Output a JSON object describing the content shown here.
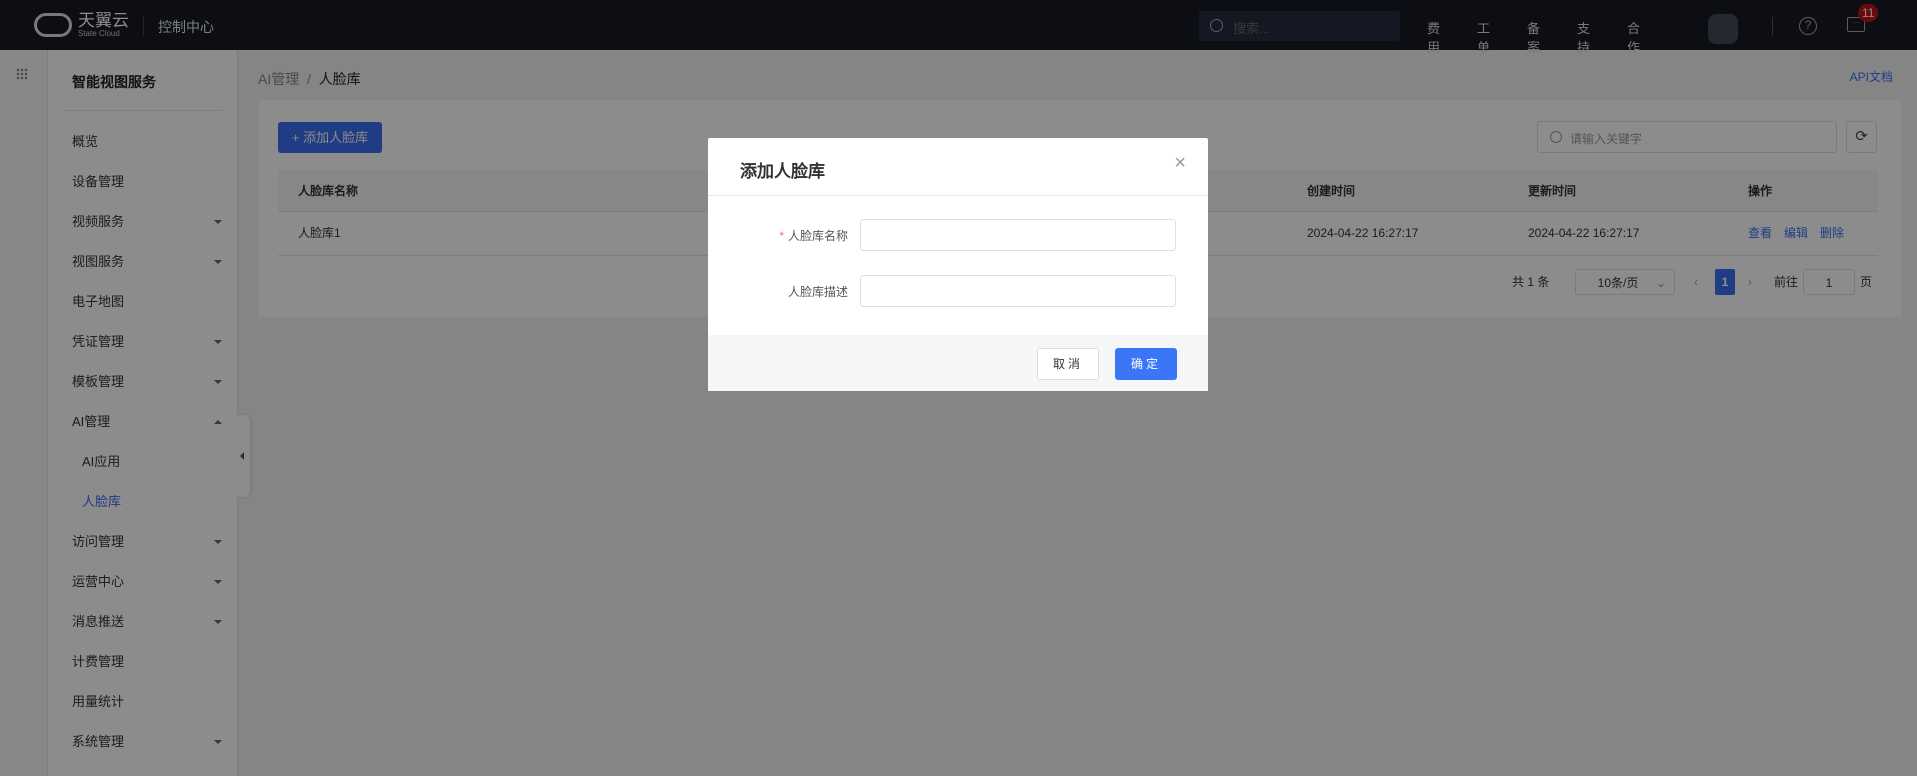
{
  "topbar": {
    "brand": "天翼云",
    "brand_sub": "State Cloud",
    "console": "控制中心",
    "search_placeholder": "搜索...",
    "links": [
      "费用",
      "工单",
      "备案",
      "支持",
      "合作"
    ],
    "help": "?",
    "msg_icon": "···",
    "badge": "11"
  },
  "sidebar": {
    "title": "智能视图服务",
    "items": [
      {
        "label": "概览",
        "caret": ""
      },
      {
        "label": "设备管理",
        "caret": ""
      },
      {
        "label": "视频服务",
        "caret": "down"
      },
      {
        "label": "视图服务",
        "caret": "down"
      },
      {
        "label": "电子地图",
        "caret": ""
      },
      {
        "label": "凭证管理",
        "caret": "down"
      },
      {
        "label": "模板管理",
        "caret": "down"
      },
      {
        "label": "AI管理",
        "caret": "up"
      },
      {
        "label": "AI应用",
        "sub": true
      },
      {
        "label": "人脸库",
        "sub": true,
        "active": true
      },
      {
        "label": "访问管理",
        "caret": "down"
      },
      {
        "label": "运营中心",
        "caret": "down"
      },
      {
        "label": "消息推送",
        "caret": "down"
      },
      {
        "label": "计费管理",
        "caret": ""
      },
      {
        "label": "用量统计",
        "caret": ""
      },
      {
        "label": "系统管理",
        "caret": "down"
      }
    ]
  },
  "breadcrumb": {
    "parent": "AI管理",
    "sep": "/",
    "current": "人脸库"
  },
  "api_doc": "API文档",
  "toolbar": {
    "add": "+ 添加人脸库",
    "search_placeholder": "请输入关键字",
    "refresh": "⟳"
  },
  "table": {
    "headers": {
      "name": "人脸库名称",
      "created": "创建时间",
      "updated": "更新时间",
      "actions": "操作"
    },
    "rows": [
      {
        "name": "人脸库1",
        "created": "2024-04-22 16:27:17",
        "updated": "2024-04-22 16:27:17",
        "actions": [
          "查看",
          "编辑",
          "删除"
        ]
      }
    ]
  },
  "pagination": {
    "total": "共 1 条",
    "page_size": "10条/页",
    "current": "1",
    "goto_label": "前往",
    "goto_value": "1",
    "page_suffix": "页",
    "prev": "‹",
    "next": "›"
  },
  "modal": {
    "title": "添加人脸库",
    "close": "×",
    "fields": [
      {
        "label": "人脸库名称",
        "required": "*",
        "value": ""
      },
      {
        "label": "人脸库描述",
        "value": ""
      }
    ],
    "cancel": "取消",
    "ok": "确定"
  }
}
